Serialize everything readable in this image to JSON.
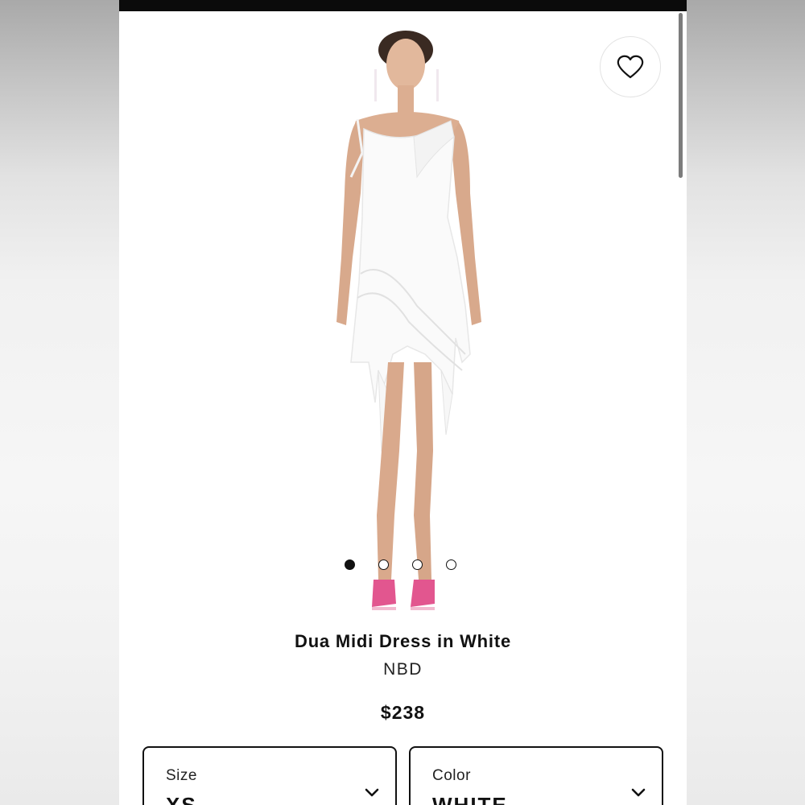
{
  "product": {
    "title": "Dua Midi Dress in White",
    "brand": "NBD",
    "price": "$238",
    "image_count": 4,
    "active_image_index": 0
  },
  "icons": {
    "favorite": "heart-outline-icon",
    "dropdown": "chevron-down-icon"
  },
  "options": {
    "size": {
      "label": "Size",
      "value": "XS"
    },
    "color": {
      "label": "Color",
      "value": "WHITE"
    }
  },
  "colors": {
    "text": "#111111",
    "status_bar": "#0b0b0b",
    "border": "#111111",
    "shoe_pink": "#e2568f"
  }
}
